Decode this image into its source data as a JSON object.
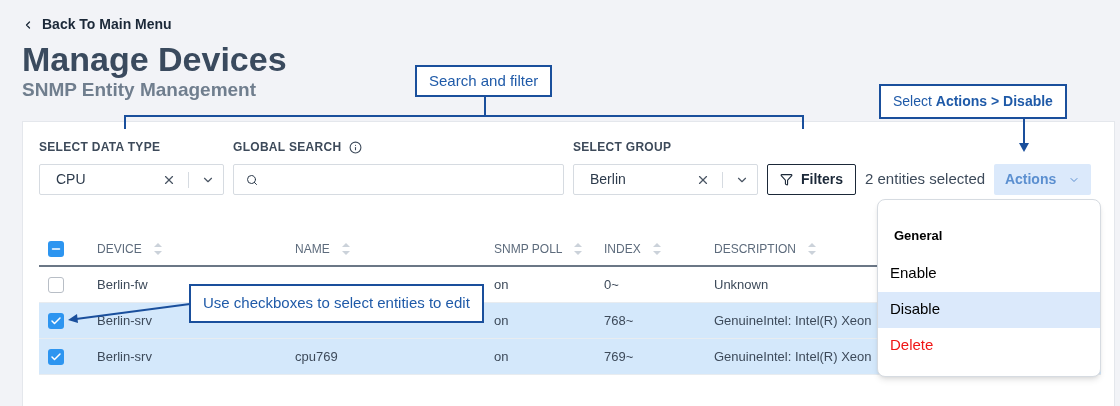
{
  "back_link": {
    "label": "Back To Main Menu"
  },
  "title": "Manage Devices",
  "subtitle": "SNMP Entity Management",
  "filters": {
    "data_type": {
      "label": "SELECT DATA TYPE",
      "value": "CPU"
    },
    "global_search": {
      "label": "GLOBAL SEARCH"
    },
    "group": {
      "label": "SELECT GROUP",
      "value": "Berlin"
    },
    "filters_button": "Filters",
    "selection_text": "2 entities selected",
    "actions_button": {
      "label": "Actions",
      "disabled": true
    }
  },
  "table": {
    "header_checkbox": {
      "indeterminate": true
    },
    "columns": [
      "DEVICE",
      "NAME",
      "SNMP POLL",
      "INDEX",
      "DESCRIPTION"
    ],
    "rows": [
      {
        "selected": false,
        "device": "Berlin-fw",
        "snmp_poll": "on",
        "index": "0~",
        "description": "Unknown"
      },
      {
        "selected": true,
        "device": "Berlin-srv",
        "snmp_poll": "on",
        "index": "768~",
        "description": "GenuineIntel: Intel(R) Xeon"
      },
      {
        "selected": true,
        "device": "Berlin-srv",
        "name": "cpu769",
        "snmp_poll": "on",
        "index": "769~",
        "description": "GenuineIntel: Intel(R) Xeon"
      }
    ]
  },
  "actions_menu": {
    "heading": "General",
    "items": [
      {
        "label": "Enable",
        "selected": false,
        "kind": "normal"
      },
      {
        "label": "Disable",
        "selected": true,
        "kind": "normal"
      },
      {
        "label": "Delete",
        "selected": false,
        "kind": "danger"
      }
    ]
  },
  "callouts": [
    {
      "kind": "bracket",
      "text": "Search and filter"
    },
    {
      "kind": "arrow_down",
      "text": "Select **Actions > Disable**"
    },
    {
      "kind": "arrow_left",
      "text": "Use checkboxes to select entities to edit"
    }
  ]
}
